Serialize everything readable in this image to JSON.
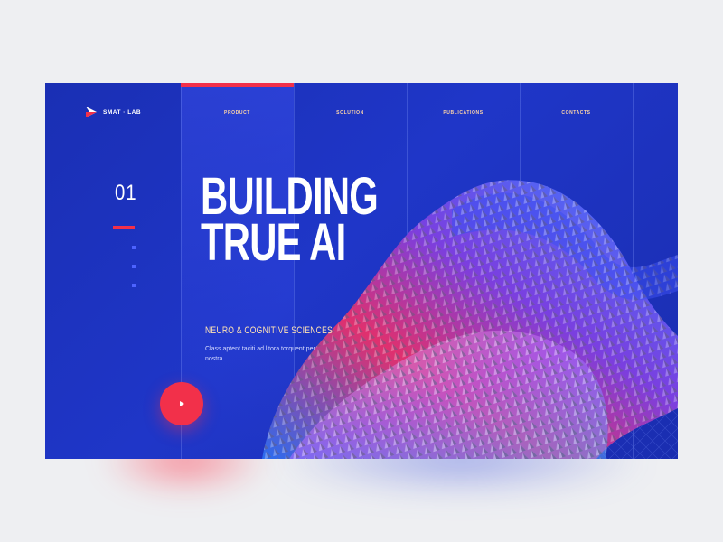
{
  "brand": {
    "name": "SMAT · LAB"
  },
  "nav": {
    "items": [
      {
        "label": "PRODUCT",
        "active": true
      },
      {
        "label": "SOLUTION",
        "active": false
      },
      {
        "label": "PUBLICATIONS",
        "active": false
      },
      {
        "label": "CONTACTS",
        "active": false
      }
    ]
  },
  "hero": {
    "slide_number": "01",
    "headline_line1": "BUILDING",
    "headline_line2": "TRUE AI",
    "subtitle": "NEURO & COGNITIVE SCIENCES",
    "description": "Class aptent taciti ad litora torquent per nostra."
  },
  "pagination": {
    "dots": 3,
    "current": 1
  },
  "play_button": {
    "icon": "play-icon"
  },
  "colors": {
    "background": "#1f36c8",
    "accent": "#f2304a",
    "nav_text": "#ffd6a8",
    "dot": "#4d63ff"
  }
}
